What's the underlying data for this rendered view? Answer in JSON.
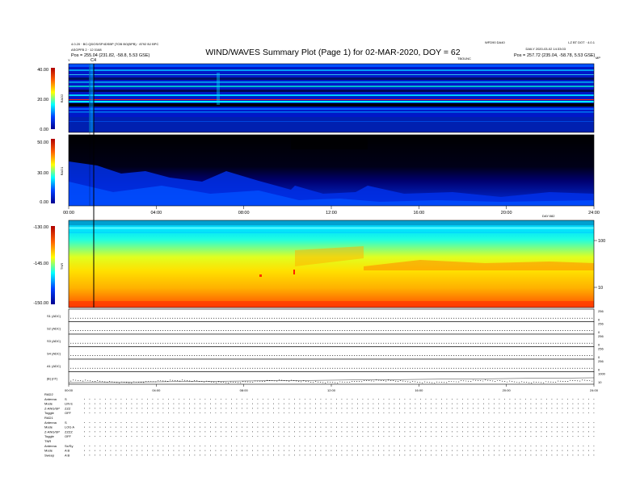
{
  "header": {
    "title": "WIND/WAVES Summary Plot (Page 1) for 02-MAR-2020, DOY = 62",
    "left_line1": "4.0.20 · BC:QDOS/SP4DSBP (TOB BO(BPB) · 8792 BJ BPC",
    "left_line2": "ASGPFB 2 · 12 0168",
    "left_pos_label": "Pos =",
    "left_pos_value": "255.04 (231.82, -58.8, 5.53 GSE)",
    "right_line1": "LZ BT DOT · 4.0.1",
    "right_line2": "DAILY 2020-03-02 14:33:03",
    "right_pos_label": "Pos =",
    "right_pos_value": "257.72 (235.04, -58.78, 5.53 GSE)",
    "center_small": "WFD90 DA40",
    "tb_label": "TBOUNC",
    "corner_y": "Y",
    "corner_mp": "MP",
    "marker_label": "C4"
  },
  "panels": {
    "rad2": {
      "label": "RAD2",
      "ticks": [
        "40.00",
        "20.00",
        "0.00"
      ]
    },
    "rad1": {
      "label": "RAD1",
      "ticks": [
        "50.00",
        "30.00",
        "0.00"
      ]
    },
    "tnr": {
      "label": "TNR",
      "ticks": [
        "-130.00",
        "-145.00",
        "-150.00"
      ],
      "right_ticks": [
        "100",
        "10"
      ],
      "right_title": "(dB)/SIGMA"
    }
  },
  "time_axis_upper": {
    "ticks": [
      "00:00",
      "04:00",
      "08:00",
      "12:00",
      "16:00",
      "20:00",
      "24:00"
    ],
    "note": "DAY:082"
  },
  "time_axis_lower": {
    "ticks": [
      "00:00",
      "04:00",
      "08:00",
      "12:00",
      "16:00",
      "20:00",
      "24:00"
    ]
  },
  "line_panels": [
    {
      "label": "S1 (ADC)",
      "right_ticks": [
        "256",
        "0"
      ]
    },
    {
      "label": "S2 (ADC)",
      "right_ticks": [
        "256",
        "0"
      ]
    },
    {
      "label": "S3 (ADC)",
      "right_ticks": [
        "256",
        "0"
      ]
    },
    {
      "label": "S4 (ADC)",
      "right_ticks": [
        "256",
        "0"
      ]
    },
    {
      "label": "A1 (ADC)",
      "right_ticks": [
        "256",
        "0"
      ]
    },
    {
      "label": "|B| (nT)",
      "right_ticks": [
        "1000",
        "10"
      ]
    }
  ],
  "footer": {
    "rad2": {
      "title": "RAD2",
      "rows": [
        [
          "Antenna",
          "S"
        ],
        [
          "Mode",
          "LIN E"
        ],
        [
          "Z-ANG/SP",
          "ZZZ"
        ],
        [
          "Toggle",
          "OFF"
        ]
      ]
    },
    "rad1": {
      "title": "RAD1",
      "rows": [
        [
          "Antenna",
          "S"
        ],
        [
          "Mode",
          "LOG A"
        ],
        [
          "Z-ANG/SP",
          "ZZZZ"
        ],
        [
          "Toggle",
          "OFF"
        ]
      ]
    },
    "tnr": {
      "title": "TNR",
      "rows": [
        [
          "Antenna",
          "Sx/Sy"
        ],
        [
          "Mode",
          "A B"
        ],
        [
          "Sweep",
          "A B"
        ]
      ]
    }
  },
  "chart_data": {
    "type": "heatmap",
    "title": "WIND/WAVES Summary Plot (Page 1) for 02-MAR-2020, DOY = 62",
    "x_range": [
      "00:00",
      "24:00"
    ],
    "panels": [
      {
        "name": "RAD2",
        "ylim": [
          0,
          40
        ],
        "colorscale": "jet",
        "dominant": "blue background with persistent horizontal cyan/red narrowband lines"
      },
      {
        "name": "RAD1",
        "ylim": [
          0,
          50
        ],
        "colorscale": "jet",
        "dominant": "blue with black low-intensity band above ~30 kHz"
      },
      {
        "name": "TNR",
        "ylim": [
          -150,
          -130
        ],
        "colorscale": "jet",
        "dominant": "red/orange at low frequency grading to cyan/blue at top; intensity boundary at ~45% height rising after 10:00"
      }
    ],
    "colors": {
      "black": "#000000",
      "blue": "#0000b0",
      "cyan": "#00c8ff",
      "yellow": "#ffff00",
      "red": "#ff2000"
    }
  }
}
